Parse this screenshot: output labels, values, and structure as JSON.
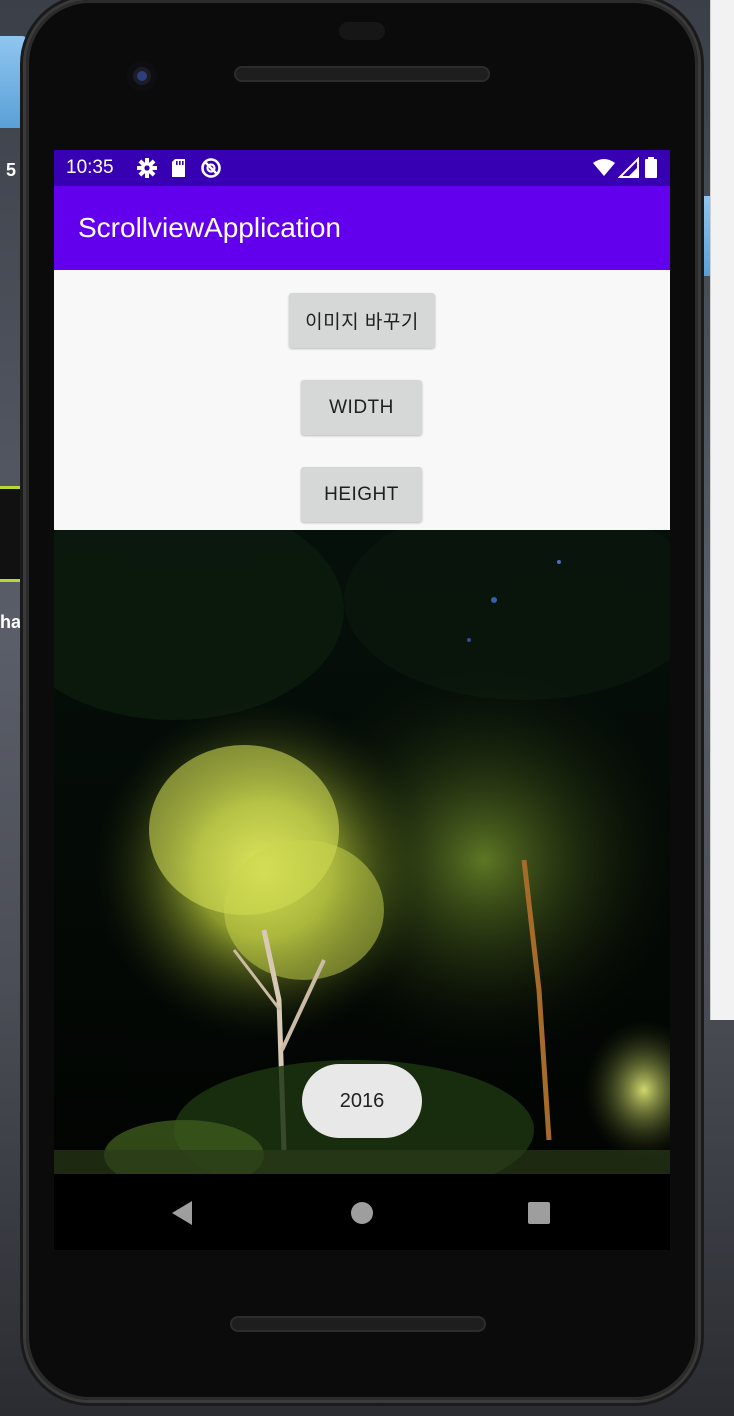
{
  "status_bar": {
    "time": "10:35",
    "left_icons": [
      "gear-icon",
      "sd-card-icon",
      "sync-icon"
    ],
    "right_icons": [
      "wifi-icon",
      "cell-signal-icon",
      "battery-icon"
    ]
  },
  "app_bar": {
    "title": "ScrollviewApplication",
    "color": "#6200ee",
    "status_color": "#3700b3"
  },
  "buttons": {
    "change_image": "이미지 바꾸기",
    "width": "WIDTH",
    "height": "HEIGHT"
  },
  "toast": {
    "text": "2016"
  },
  "nav_bar": {
    "icons": [
      "back-icon",
      "home-icon",
      "recents-icon"
    ]
  },
  "desktop": {
    "label_1": "5",
    "label_2": "har"
  }
}
